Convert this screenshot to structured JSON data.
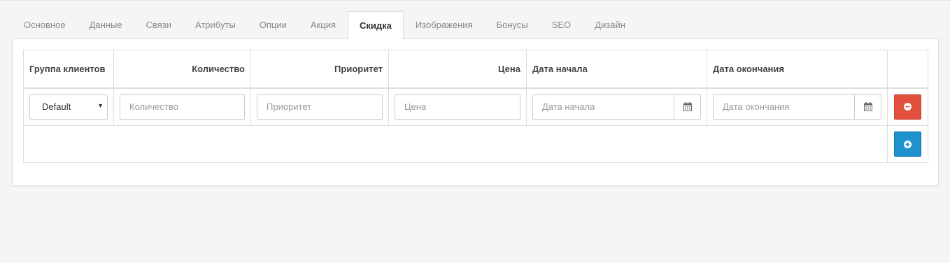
{
  "tabs": [
    {
      "label": "Основное",
      "active": false
    },
    {
      "label": "Данные",
      "active": false
    },
    {
      "label": "Связи",
      "active": false
    },
    {
      "label": "Атрибуты",
      "active": false
    },
    {
      "label": "Опции",
      "active": false
    },
    {
      "label": "Акция",
      "active": false
    },
    {
      "label": "Скидка",
      "active": true
    },
    {
      "label": "Изображения",
      "active": false
    },
    {
      "label": "Бонусы",
      "active": false
    },
    {
      "label": "SEO",
      "active": false
    },
    {
      "label": "Дизайн",
      "active": false
    }
  ],
  "table": {
    "headers": {
      "customer_group": "Группа клиентов",
      "quantity": "Количество",
      "priority": "Приоритет",
      "price": "Цена",
      "date_start": "Дата начала",
      "date_end": "Дата окончания"
    },
    "row": {
      "customer_group_value": "Default",
      "quantity_placeholder": "Количество",
      "priority_placeholder": "Приоритет",
      "price_placeholder": "Цена",
      "date_start_placeholder": "Дата начала",
      "date_end_placeholder": "Дата окончания"
    }
  },
  "icons": {
    "calendar": "calendar-icon",
    "remove": "minus-circle-icon",
    "add": "plus-circle-icon",
    "caret": "caret-down-icon"
  },
  "colors": {
    "remove_button": "#e3503e",
    "add_button": "#1e91cf"
  }
}
